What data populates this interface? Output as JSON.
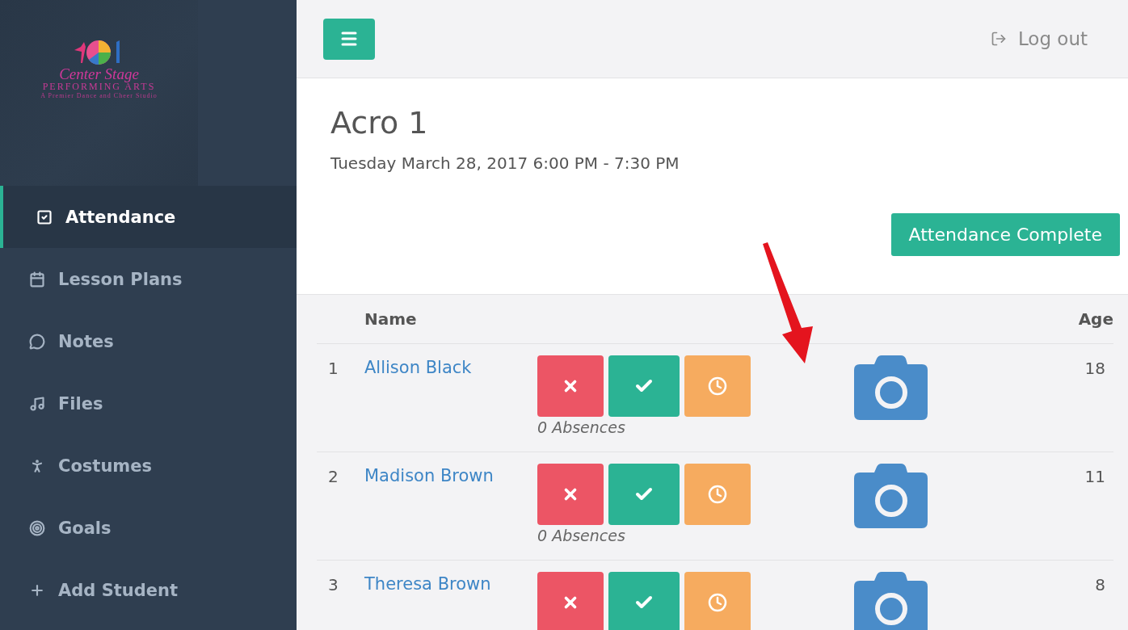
{
  "logo": {
    "title": "Center Stage",
    "subtitle": "PERFORMING ARTS",
    "tagline": "A Premier Dance and Cheer Studio"
  },
  "sidebar": {
    "items": [
      {
        "label": "Attendance",
        "selected": true
      },
      {
        "label": "Lesson Plans",
        "selected": false
      },
      {
        "label": "Notes",
        "selected": false
      },
      {
        "label": "Files",
        "selected": false
      },
      {
        "label": "Costumes",
        "selected": false
      },
      {
        "label": "Goals",
        "selected": false
      },
      {
        "label": "Add Student",
        "selected": false
      }
    ]
  },
  "topbar": {
    "logout": "Log out"
  },
  "class": {
    "title": "Acro 1",
    "schedule": "Tuesday March 28, 2017 6:00 PM - 7:30 PM",
    "complete_button": "Attendance Complete"
  },
  "table": {
    "columns": [
      "Name",
      "Age"
    ],
    "rows": [
      {
        "number": "1",
        "name": "Allison Black",
        "absences": "0 Absences",
        "age": "18"
      },
      {
        "number": "2",
        "name": "Madison Brown",
        "absences": "0 Absences",
        "age": "11"
      },
      {
        "number": "3",
        "name": "Theresa Brown",
        "age": "8"
      }
    ]
  }
}
